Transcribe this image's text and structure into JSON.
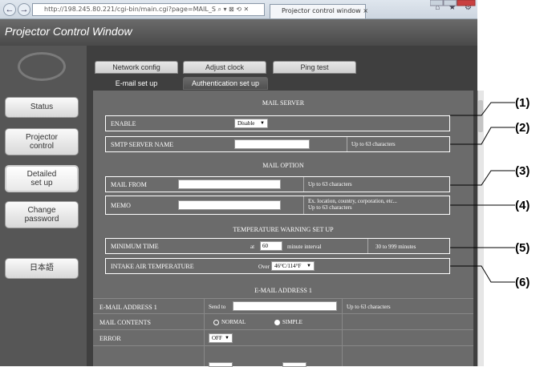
{
  "browser": {
    "url": "http://198.245.80.221/cgi-bin/main.cgi?page=MAIL_S",
    "url_tools": "⌕ ▾ ⊠ ⟲ ✕",
    "tab_title": "Projector control window",
    "tab_close": "×",
    "right_icons": "⌂ ★ ⚙"
  },
  "app": {
    "title": "Projector Control Window"
  },
  "sidebar": {
    "items": [
      {
        "label": "Status"
      },
      {
        "label": "Projector\ncontrol"
      },
      {
        "label": "Detailed\nset up",
        "active": true
      },
      {
        "label": "Change\npassword"
      },
      {
        "label": "日本語"
      }
    ]
  },
  "tabs": {
    "row1": [
      "Network config",
      "Adjust clock",
      "Ping test"
    ],
    "row2": [
      "E-mail set up",
      "Authentication set up"
    ]
  },
  "mail_server": {
    "heading": "MAIL SERVER",
    "enable_label": "ENABLE",
    "enable_value": "Disable",
    "smtp_label": "SMTP SERVER NAME",
    "smtp_value": "",
    "smtp_note": "Up to 63 characters"
  },
  "mail_option": {
    "heading": "MAIL OPTION",
    "from_label": "MAIL FROM",
    "from_note": "Up to 63 characters",
    "memo_label": "MEMO",
    "memo_note": "Ex. location, country, corporation, etc...\nUp to 63 characters"
  },
  "temperature": {
    "heading": "TEMPERATURE WARNING SET UP",
    "min_time_label": "MINIMUM TIME",
    "min_time_prefix": "at",
    "min_time_value": "60",
    "min_time_suffix": "minute interval",
    "min_time_note": "30 to 999 minutes",
    "intake_label": "INTAKE AIR TEMPERATURE",
    "intake_prefix": "Over",
    "intake_value": "46°C/114°F"
  },
  "email1": {
    "heading": "E-MAIL ADDRESS 1",
    "addr_label": "E-MAIL ADDRESS 1",
    "addr_prefix": "Send to",
    "addr_note": "Up to 63 characters",
    "contents_label": "MAIL CONTENTS",
    "contents_options": [
      "NORMAL",
      "SIMPLE"
    ],
    "contents_selected": "SIMPLE",
    "error_label": "ERROR",
    "error_value": "OFF"
  },
  "callouts": [
    "(1)",
    "(2)",
    "(3)",
    "(4)",
    "(5)",
    "(6)"
  ]
}
